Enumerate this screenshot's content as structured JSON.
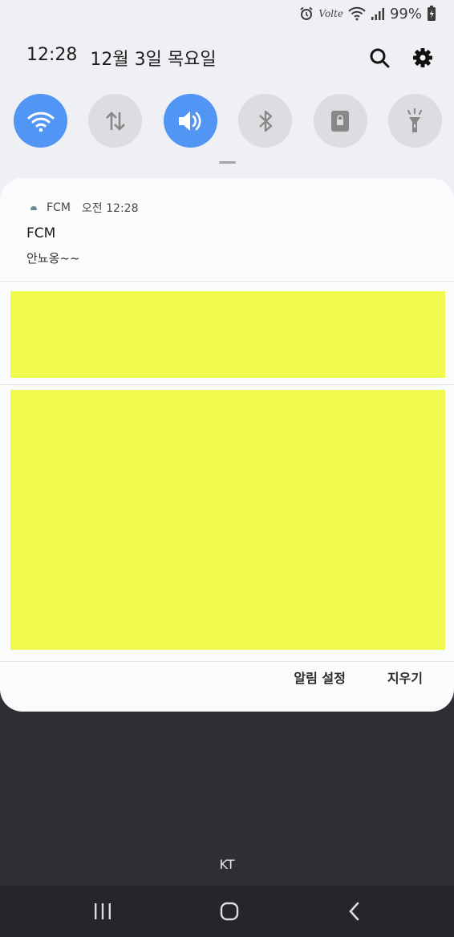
{
  "status_bar": {
    "volte_label": "Volte",
    "battery_percent": "99%",
    "icons": [
      "alarm-icon",
      "volte-icon",
      "wifi-icon",
      "signal-icon",
      "battery-charging-icon"
    ]
  },
  "header": {
    "time": "12:28",
    "date": "12월 3일 목요일",
    "icons": [
      "search-icon",
      "settings-gear-icon"
    ]
  },
  "quick_toggles": [
    {
      "name": "wifi",
      "active": true
    },
    {
      "name": "mobile-data",
      "active": false
    },
    {
      "name": "sound",
      "active": true
    },
    {
      "name": "bluetooth",
      "active": false
    },
    {
      "name": "portrait-lock",
      "active": false
    },
    {
      "name": "flashlight",
      "active": false
    }
  ],
  "colors": {
    "toggle_active": "#5195f5",
    "toggle_inactive": "#dcdde0",
    "redaction": "#f1f94f"
  },
  "notification": {
    "app_name": "FCM",
    "time": "오전 12:28",
    "title": "FCM",
    "body": "안뇨옹~~"
  },
  "footer": {
    "notification_settings": "알림 설정",
    "clear": "지우기"
  },
  "carrier": "KT",
  "nav_bar": [
    "recent-apps-icon",
    "home-icon",
    "back-icon"
  ]
}
